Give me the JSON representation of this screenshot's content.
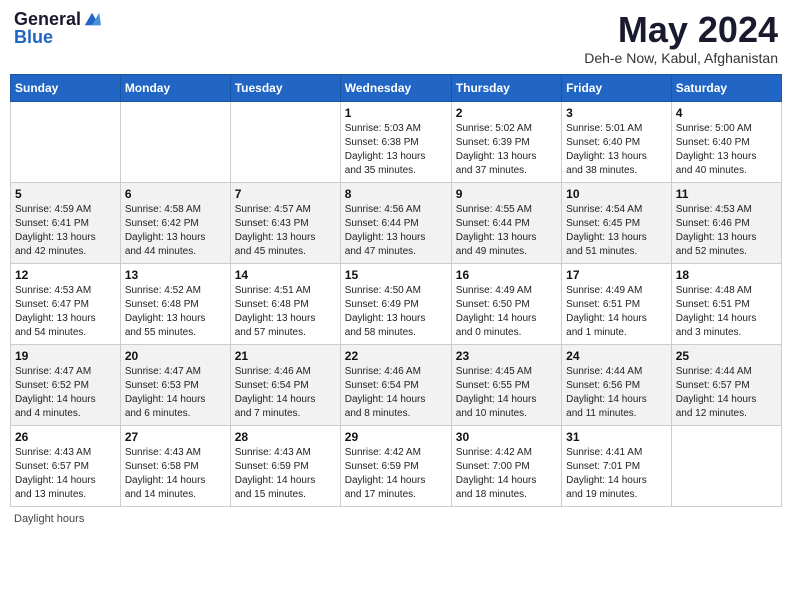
{
  "header": {
    "logo_general": "General",
    "logo_blue": "Blue",
    "month_title": "May 2024",
    "location": "Deh-e Now, Kabul, Afghanistan"
  },
  "days_of_week": [
    "Sunday",
    "Monday",
    "Tuesday",
    "Wednesday",
    "Thursday",
    "Friday",
    "Saturday"
  ],
  "weeks": [
    [
      {
        "day": "",
        "info": ""
      },
      {
        "day": "",
        "info": ""
      },
      {
        "day": "",
        "info": ""
      },
      {
        "day": "1",
        "info": "Sunrise: 5:03 AM\nSunset: 6:38 PM\nDaylight: 13 hours\nand 35 minutes."
      },
      {
        "day": "2",
        "info": "Sunrise: 5:02 AM\nSunset: 6:39 PM\nDaylight: 13 hours\nand 37 minutes."
      },
      {
        "day": "3",
        "info": "Sunrise: 5:01 AM\nSunset: 6:40 PM\nDaylight: 13 hours\nand 38 minutes."
      },
      {
        "day": "4",
        "info": "Sunrise: 5:00 AM\nSunset: 6:40 PM\nDaylight: 13 hours\nand 40 minutes."
      }
    ],
    [
      {
        "day": "5",
        "info": "Sunrise: 4:59 AM\nSunset: 6:41 PM\nDaylight: 13 hours\nand 42 minutes."
      },
      {
        "day": "6",
        "info": "Sunrise: 4:58 AM\nSunset: 6:42 PM\nDaylight: 13 hours\nand 44 minutes."
      },
      {
        "day": "7",
        "info": "Sunrise: 4:57 AM\nSunset: 6:43 PM\nDaylight: 13 hours\nand 45 minutes."
      },
      {
        "day": "8",
        "info": "Sunrise: 4:56 AM\nSunset: 6:44 PM\nDaylight: 13 hours\nand 47 minutes."
      },
      {
        "day": "9",
        "info": "Sunrise: 4:55 AM\nSunset: 6:44 PM\nDaylight: 13 hours\nand 49 minutes."
      },
      {
        "day": "10",
        "info": "Sunrise: 4:54 AM\nSunset: 6:45 PM\nDaylight: 13 hours\nand 51 minutes."
      },
      {
        "day": "11",
        "info": "Sunrise: 4:53 AM\nSunset: 6:46 PM\nDaylight: 13 hours\nand 52 minutes."
      }
    ],
    [
      {
        "day": "12",
        "info": "Sunrise: 4:53 AM\nSunset: 6:47 PM\nDaylight: 13 hours\nand 54 minutes."
      },
      {
        "day": "13",
        "info": "Sunrise: 4:52 AM\nSunset: 6:48 PM\nDaylight: 13 hours\nand 55 minutes."
      },
      {
        "day": "14",
        "info": "Sunrise: 4:51 AM\nSunset: 6:48 PM\nDaylight: 13 hours\nand 57 minutes."
      },
      {
        "day": "15",
        "info": "Sunrise: 4:50 AM\nSunset: 6:49 PM\nDaylight: 13 hours\nand 58 minutes."
      },
      {
        "day": "16",
        "info": "Sunrise: 4:49 AM\nSunset: 6:50 PM\nDaylight: 14 hours\nand 0 minutes."
      },
      {
        "day": "17",
        "info": "Sunrise: 4:49 AM\nSunset: 6:51 PM\nDaylight: 14 hours\nand 1 minute."
      },
      {
        "day": "18",
        "info": "Sunrise: 4:48 AM\nSunset: 6:51 PM\nDaylight: 14 hours\nand 3 minutes."
      }
    ],
    [
      {
        "day": "19",
        "info": "Sunrise: 4:47 AM\nSunset: 6:52 PM\nDaylight: 14 hours\nand 4 minutes."
      },
      {
        "day": "20",
        "info": "Sunrise: 4:47 AM\nSunset: 6:53 PM\nDaylight: 14 hours\nand 6 minutes."
      },
      {
        "day": "21",
        "info": "Sunrise: 4:46 AM\nSunset: 6:54 PM\nDaylight: 14 hours\nand 7 minutes."
      },
      {
        "day": "22",
        "info": "Sunrise: 4:46 AM\nSunset: 6:54 PM\nDaylight: 14 hours\nand 8 minutes."
      },
      {
        "day": "23",
        "info": "Sunrise: 4:45 AM\nSunset: 6:55 PM\nDaylight: 14 hours\nand 10 minutes."
      },
      {
        "day": "24",
        "info": "Sunrise: 4:44 AM\nSunset: 6:56 PM\nDaylight: 14 hours\nand 11 minutes."
      },
      {
        "day": "25",
        "info": "Sunrise: 4:44 AM\nSunset: 6:57 PM\nDaylight: 14 hours\nand 12 minutes."
      }
    ],
    [
      {
        "day": "26",
        "info": "Sunrise: 4:43 AM\nSunset: 6:57 PM\nDaylight: 14 hours\nand 13 minutes."
      },
      {
        "day": "27",
        "info": "Sunrise: 4:43 AM\nSunset: 6:58 PM\nDaylight: 14 hours\nand 14 minutes."
      },
      {
        "day": "28",
        "info": "Sunrise: 4:43 AM\nSunset: 6:59 PM\nDaylight: 14 hours\nand 15 minutes."
      },
      {
        "day": "29",
        "info": "Sunrise: 4:42 AM\nSunset: 6:59 PM\nDaylight: 14 hours\nand 17 minutes."
      },
      {
        "day": "30",
        "info": "Sunrise: 4:42 AM\nSunset: 7:00 PM\nDaylight: 14 hours\nand 18 minutes."
      },
      {
        "day": "31",
        "info": "Sunrise: 4:41 AM\nSunset: 7:01 PM\nDaylight: 14 hours\nand 19 minutes."
      },
      {
        "day": "",
        "info": ""
      }
    ]
  ],
  "footer": {
    "daylight_label": "Daylight hours"
  }
}
